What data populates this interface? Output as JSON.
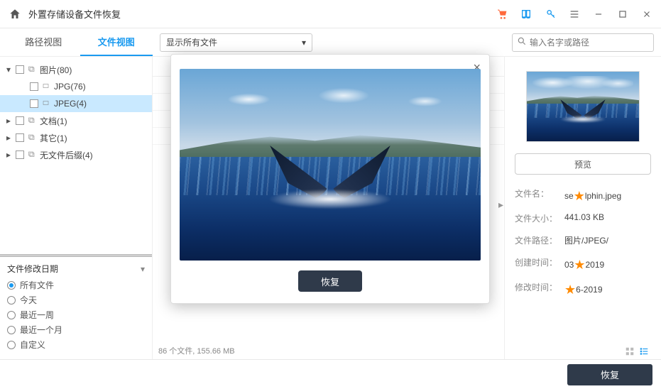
{
  "titlebar": {
    "title": "外置存储设备文件恢复"
  },
  "row2": {
    "tabs": {
      "path_view": "路径视图",
      "file_view": "文件视图"
    },
    "filter_label": "显示所有文件",
    "search_placeholder": "输入名字或路径"
  },
  "tree": [
    {
      "label": "图片(80)",
      "expanded": true,
      "depth": 0
    },
    {
      "label": "JPG(76)",
      "expanded": false,
      "depth": 1
    },
    {
      "label": "JPEG(4)",
      "expanded": false,
      "depth": 1,
      "selected": true
    },
    {
      "label": "文档(1)",
      "expanded": false,
      "depth": 0,
      "collapsed_arrow": true
    },
    {
      "label": "其它(1)",
      "expanded": false,
      "depth": 0,
      "collapsed_arrow": true
    },
    {
      "label": "无文件后缀(4)",
      "expanded": false,
      "depth": 0,
      "collapsed_arrow": true
    }
  ],
  "date_filter": {
    "title": "文件修改日期",
    "options": [
      "所有文件",
      "今天",
      "最近一周",
      "最近一个月",
      "自定义"
    ],
    "selected": 0
  },
  "preview": {
    "recover_label": "恢复"
  },
  "rpanel": {
    "preview_btn": "预览",
    "rows": {
      "name_lbl": "文件名：",
      "name_pre": "se",
      "name_post": "lphin.jpeg",
      "size_lbl": "文件大小：",
      "size_val": "441.03  KB",
      "path_lbl": "文件路径：",
      "path_val": "图片/JPEG/",
      "ctime_lbl": "创建时间：",
      "ctime_pre": "03",
      "ctime_post": "2019",
      "mtime_lbl": "修改时间：",
      "mtime_post": "6-2019"
    }
  },
  "status": "86 个文件, 155.66  MB",
  "footer": {
    "recover": "恢复"
  }
}
